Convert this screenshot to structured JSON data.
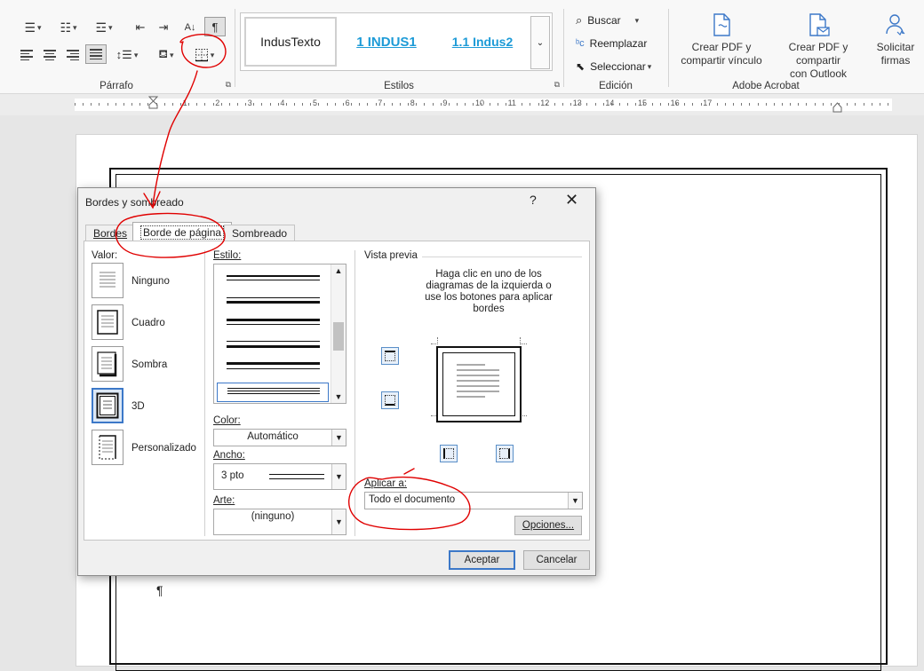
{
  "ribbon": {
    "paragraph": {
      "label": "Párrafo",
      "pilcrow": "¶",
      "launcher": "⧉"
    },
    "styles": {
      "label": "Estilos",
      "items": [
        "IndusTexto",
        "1  INDUS1",
        "1.1  Indus2"
      ],
      "more": "⌄"
    },
    "editing": {
      "label": "Edición",
      "find": "Buscar",
      "replace": "Reemplazar",
      "select": "Seleccionar"
    },
    "acrobat": {
      "label": "Adobe Acrobat",
      "create_pdf": [
        "Crear PDF y",
        "compartir vínculo"
      ],
      "create_pdf_outlook": [
        "Crear PDF y compartir",
        "con Outlook"
      ],
      "request_sign": [
        "Solicitar",
        "firmas"
      ]
    }
  },
  "ruler": {
    "numbers": [
      "1",
      "2",
      "3",
      "4",
      "5",
      "6",
      "7",
      "8",
      "9",
      "10",
      "11",
      "12",
      "13",
      "14",
      "15",
      "16",
      "17"
    ]
  },
  "document": {
    "pilcrow": "¶"
  },
  "dialog": {
    "title": "Bordes y sombreado",
    "help": "?",
    "close": "✕",
    "tabs": [
      "Bordes",
      "Borde de página",
      "Sombreado"
    ],
    "setting": {
      "label": "Valor:",
      "options": [
        "Ninguno",
        "Cuadro",
        "Sombra",
        "3D",
        "Personalizado"
      ],
      "selected": "3D"
    },
    "style": {
      "label": "Estilo:"
    },
    "color": {
      "label": "Color:",
      "value": "Automático"
    },
    "width": {
      "label": "Ancho:",
      "value": "3 pto"
    },
    "art": {
      "label": "Arte:",
      "value": "(ninguno)"
    },
    "preview": {
      "label": "Vista previa",
      "hint": [
        "Haga clic en uno de los",
        "diagramas de la izquierda o",
        "use los botones para aplicar",
        "bordes"
      ]
    },
    "apply_to": {
      "label": "Aplicar a:",
      "value": "Todo el documento"
    },
    "options_button": "Opciones...",
    "ok_button": "Aceptar",
    "cancel_button": "Cancelar"
  },
  "colors": {
    "accent": "#3c78c8",
    "heading_style": "#1d9bd7",
    "annotation": "#e00000"
  }
}
